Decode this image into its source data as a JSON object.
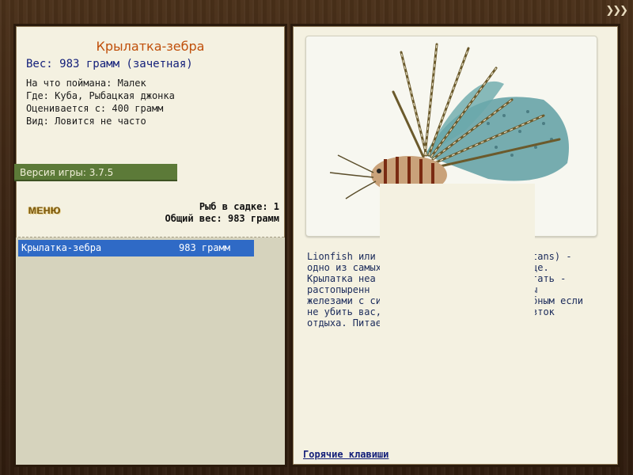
{
  "nav": {
    "arrows": "❯❯❯"
  },
  "fish": {
    "name": "Крылатка-зебра",
    "weight": "Вес: 983 грамм (зачетная)",
    "caught_with": "На что поймана: Малек",
    "location": "Где: Куба, Рыбацкая джонка",
    "min_weight": "Оценивается с: 400 грамм",
    "rarity": "Вид: Ловится не часто",
    "description_lines": [
      "Lionfish или по",
      "одно из самых",
      "Крылатка неа",
      "растопыренн",
      "железами с си",
      "не убить вас,",
      "отдыха. Питае"
    ],
    "description_right": [
      "tans) -",
      "це.",
      "гать -",
      "ы",
      "бным если",
      "зток",
      ""
    ]
  },
  "version": "Версия игры: 3.7.5",
  "menu_label": "МЕНЮ",
  "stats": {
    "count": "Рыб в садке: 1",
    "total": "Общий вес: 983 грамм"
  },
  "keepnet": [
    {
      "name": "Крылатка-зебра",
      "weight": "983 грамм"
    }
  ],
  "hotkeys": "Горячие клавиши",
  "colors": {
    "title": "#c0500b",
    "weight": "#14207a",
    "version_bar": "#5c7a38",
    "selected_row": "#2f6ac6"
  }
}
